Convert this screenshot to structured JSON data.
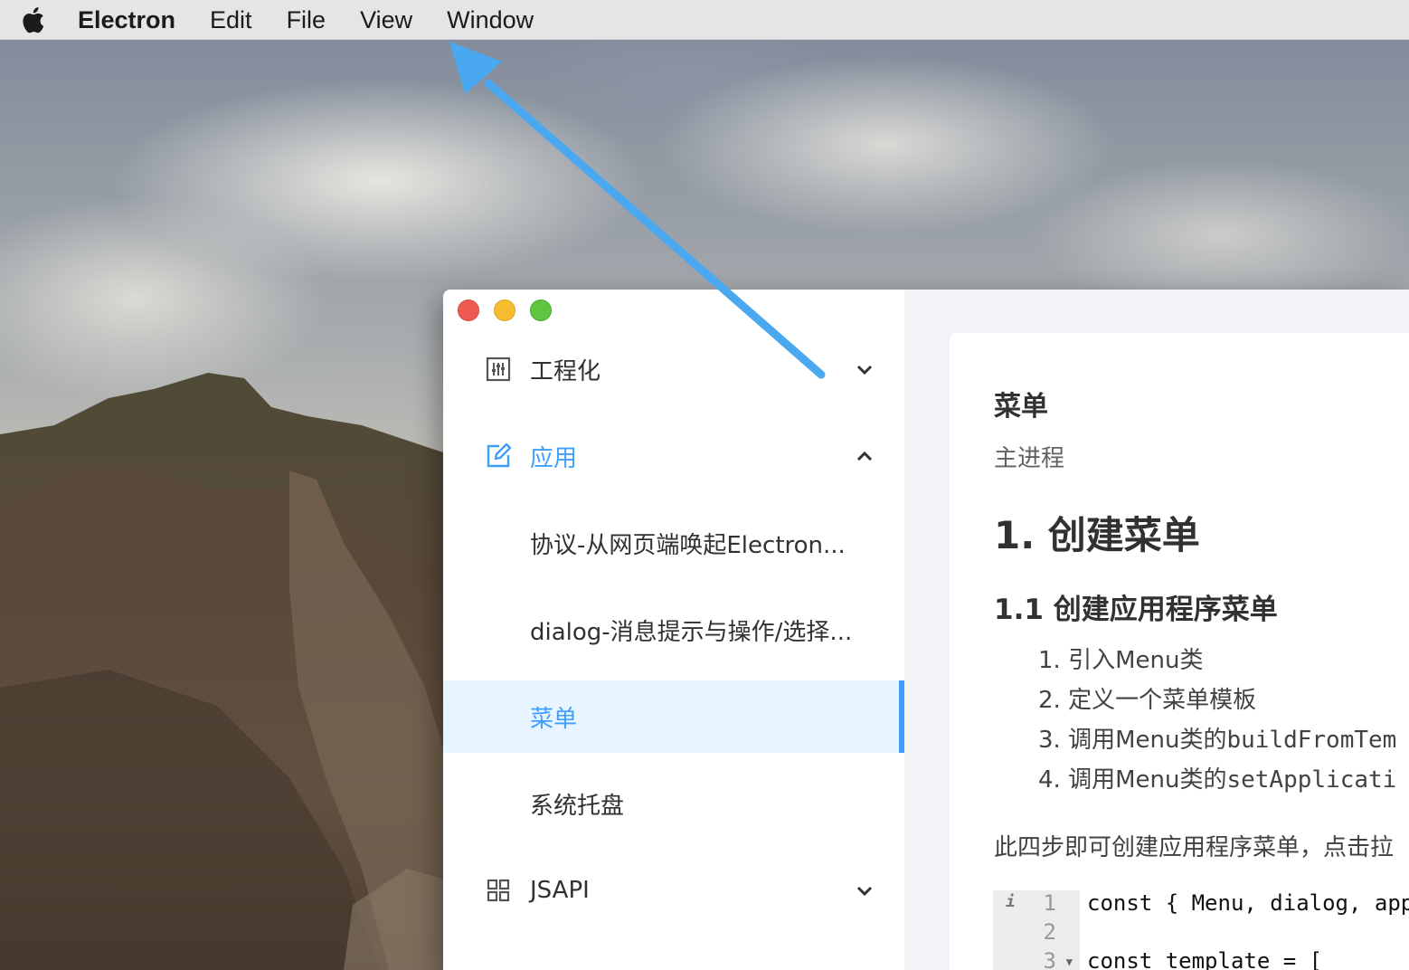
{
  "menubar": {
    "apple_icon": "apple-icon",
    "items": [
      "Electron",
      "Edit",
      "File",
      "View",
      "Window"
    ]
  },
  "annotation": {
    "color": "#4aa8f0"
  },
  "window": {
    "traffic_lights": {
      "close": "#ee5a52",
      "minimize": "#f5bd2f",
      "maximize": "#5fc440"
    }
  },
  "sidebar": {
    "accent_color": "#409eff",
    "groups": [
      {
        "label": "工程化",
        "icon": "sliders-icon",
        "state": "collapsed"
      },
      {
        "label": "应用",
        "icon": "edit-icon",
        "state": "expanded",
        "children": [
          {
            "label": "协议-从网页端唤起Electron..."
          },
          {
            "label": "dialog-消息提示与操作/选择..."
          },
          {
            "label": "菜单",
            "active": true
          },
          {
            "label": "系统托盘"
          }
        ]
      },
      {
        "label": "JSAPI",
        "icon": "grid-icon",
        "state": "collapsed"
      }
    ]
  },
  "content": {
    "title": "菜单",
    "subtitle": "主进程",
    "h1": "1. 创建菜单",
    "h2": "1.1 创建应用程序菜单",
    "steps": [
      {
        "num": "1.",
        "text": "引入Menu类",
        "code": ""
      },
      {
        "num": "2.",
        "text": "定义一个菜单模板",
        "code": ""
      },
      {
        "num": "3.",
        "text": "调用Menu类的",
        "code": "buildFromTem"
      },
      {
        "num": "4.",
        "text": "调用Menu类的",
        "code": "setApplicati"
      }
    ],
    "summary": "此四步即可创建应用程序菜单，点击拉",
    "code": {
      "lines": [
        "const { Menu, dialog, app",
        "",
        "const template = ["
      ],
      "line_numbers": [
        "1",
        "2",
        "3"
      ]
    }
  }
}
